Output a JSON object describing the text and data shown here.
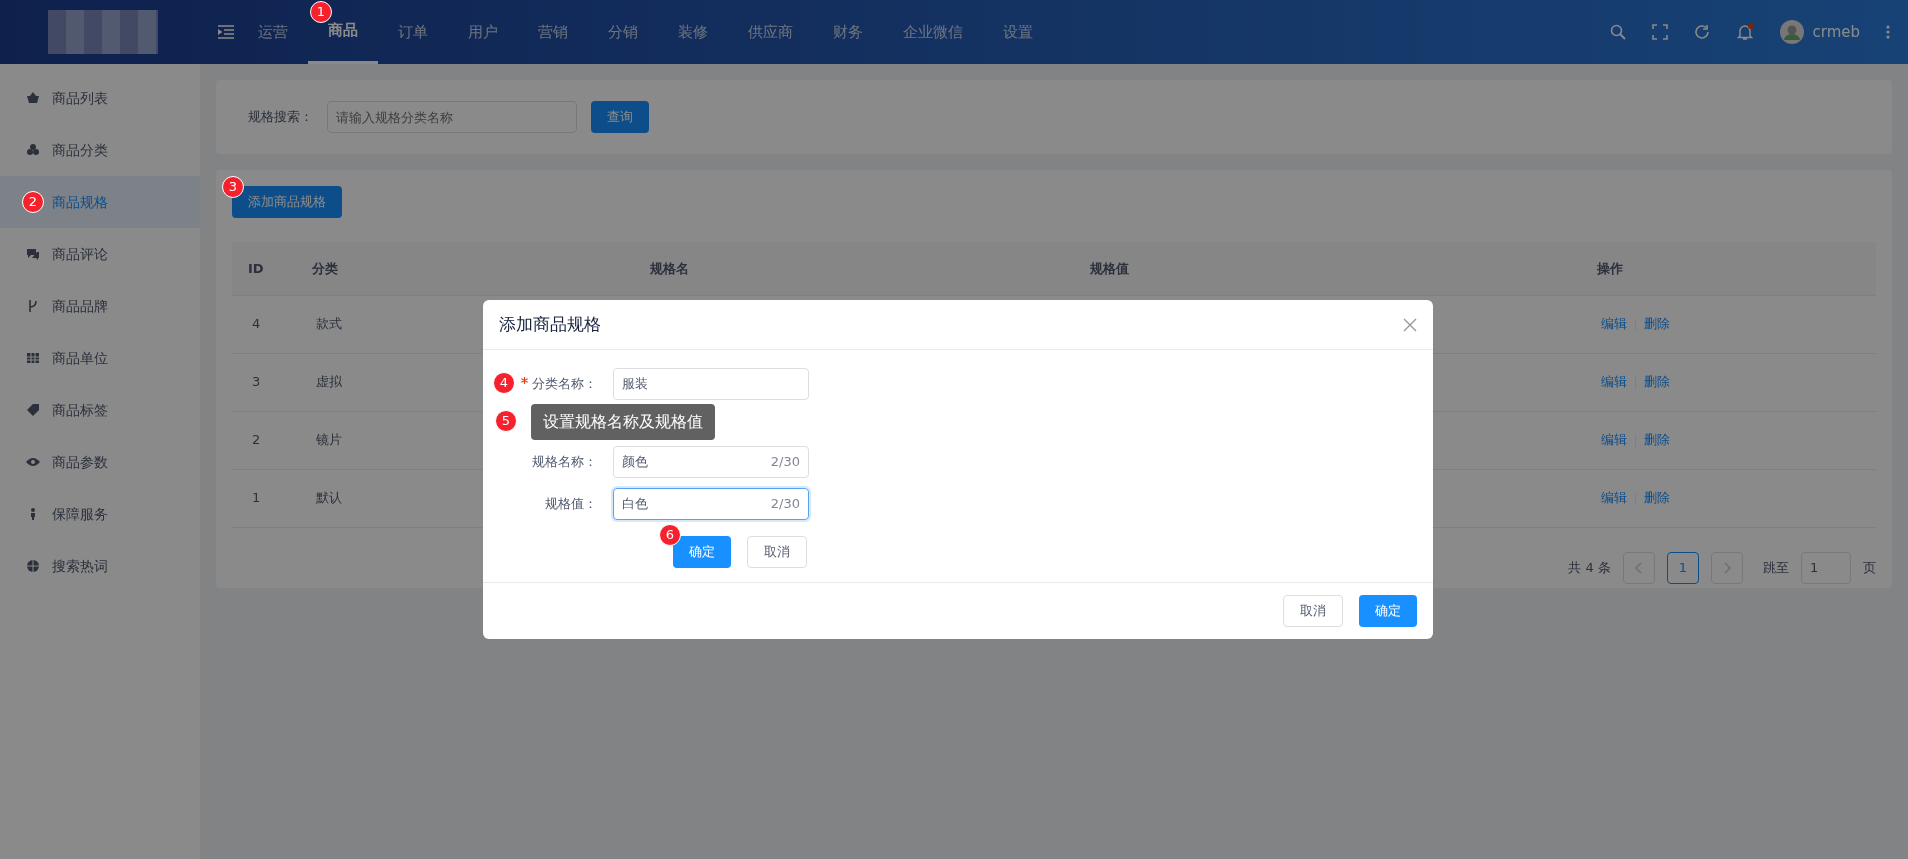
{
  "header": {
    "nav": [
      {
        "label": "运营",
        "selected": false
      },
      {
        "label": "商品",
        "selected": true,
        "badge": "1"
      },
      {
        "label": "订单",
        "selected": false
      },
      {
        "label": "用户",
        "selected": false
      },
      {
        "label": "营销",
        "selected": false
      },
      {
        "label": "分销",
        "selected": false
      },
      {
        "label": "装修",
        "selected": false
      },
      {
        "label": "供应商",
        "selected": false
      },
      {
        "label": "财务",
        "selected": false
      },
      {
        "label": "企业微信",
        "selected": false
      },
      {
        "label": "设置",
        "selected": false
      }
    ],
    "has_notification": true,
    "username": "crmeb"
  },
  "sidebar": {
    "items": [
      {
        "label": "商品列表",
        "selected": false
      },
      {
        "label": "商品分类",
        "selected": false
      },
      {
        "label": "商品规格",
        "selected": true,
        "badge": "2"
      },
      {
        "label": "商品评论",
        "selected": false
      },
      {
        "label": "商品品牌",
        "selected": false
      },
      {
        "label": "商品单位",
        "selected": false
      },
      {
        "label": "商品标签",
        "selected": false
      },
      {
        "label": "商品参数",
        "selected": false
      },
      {
        "label": "保障服务",
        "selected": false
      },
      {
        "label": "搜索热词",
        "selected": false
      }
    ]
  },
  "search": {
    "label": "规格搜索：",
    "placeholder": "请输入规格分类名称",
    "button": "查询"
  },
  "add_button": {
    "label": "添加商品规格",
    "badge": "3"
  },
  "table": {
    "columns": [
      "ID",
      "分类",
      "规格名",
      "规格值",
      "操作"
    ],
    "rows": [
      {
        "id": "4",
        "category": "款式",
        "actions": [
          "编辑",
          "删除"
        ]
      },
      {
        "id": "3",
        "category": "虚拟",
        "actions": [
          "编辑",
          "删除"
        ]
      },
      {
        "id": "2",
        "category": "镜片",
        "actions": [
          "编辑",
          "删除"
        ]
      },
      {
        "id": "1",
        "category": "默认",
        "actions": [
          "编辑",
          "删除"
        ]
      }
    ]
  },
  "pagination": {
    "total": "共 4 条",
    "pages": [
      {
        "label": "1",
        "selected": true
      }
    ],
    "jump_label": "跳至",
    "jump_value": "1",
    "page_suffix": "页"
  },
  "modal": {
    "title": "添加商品规格",
    "fields": [
      {
        "label": "分类名称：",
        "value": "服装",
        "required": true,
        "badge": "4",
        "focused": false
      },
      {
        "kind": "tooltip",
        "text": "设置规格名称及规格值",
        "badge": "5"
      },
      {
        "label": "规格名称：",
        "value": "颜色",
        "counter": "2/30",
        "required": false,
        "focused": false
      },
      {
        "label": "规格值：",
        "value": "白色",
        "counter": "2/30",
        "required": false,
        "focused": true
      }
    ],
    "inline_buttons": [
      {
        "label": "确定",
        "primary": true,
        "badge": "6"
      },
      {
        "label": "取消",
        "primary": false
      }
    ],
    "footer_buttons": [
      {
        "label": "取消",
        "primary": false
      },
      {
        "label": "确定",
        "primary": true
      }
    ]
  }
}
